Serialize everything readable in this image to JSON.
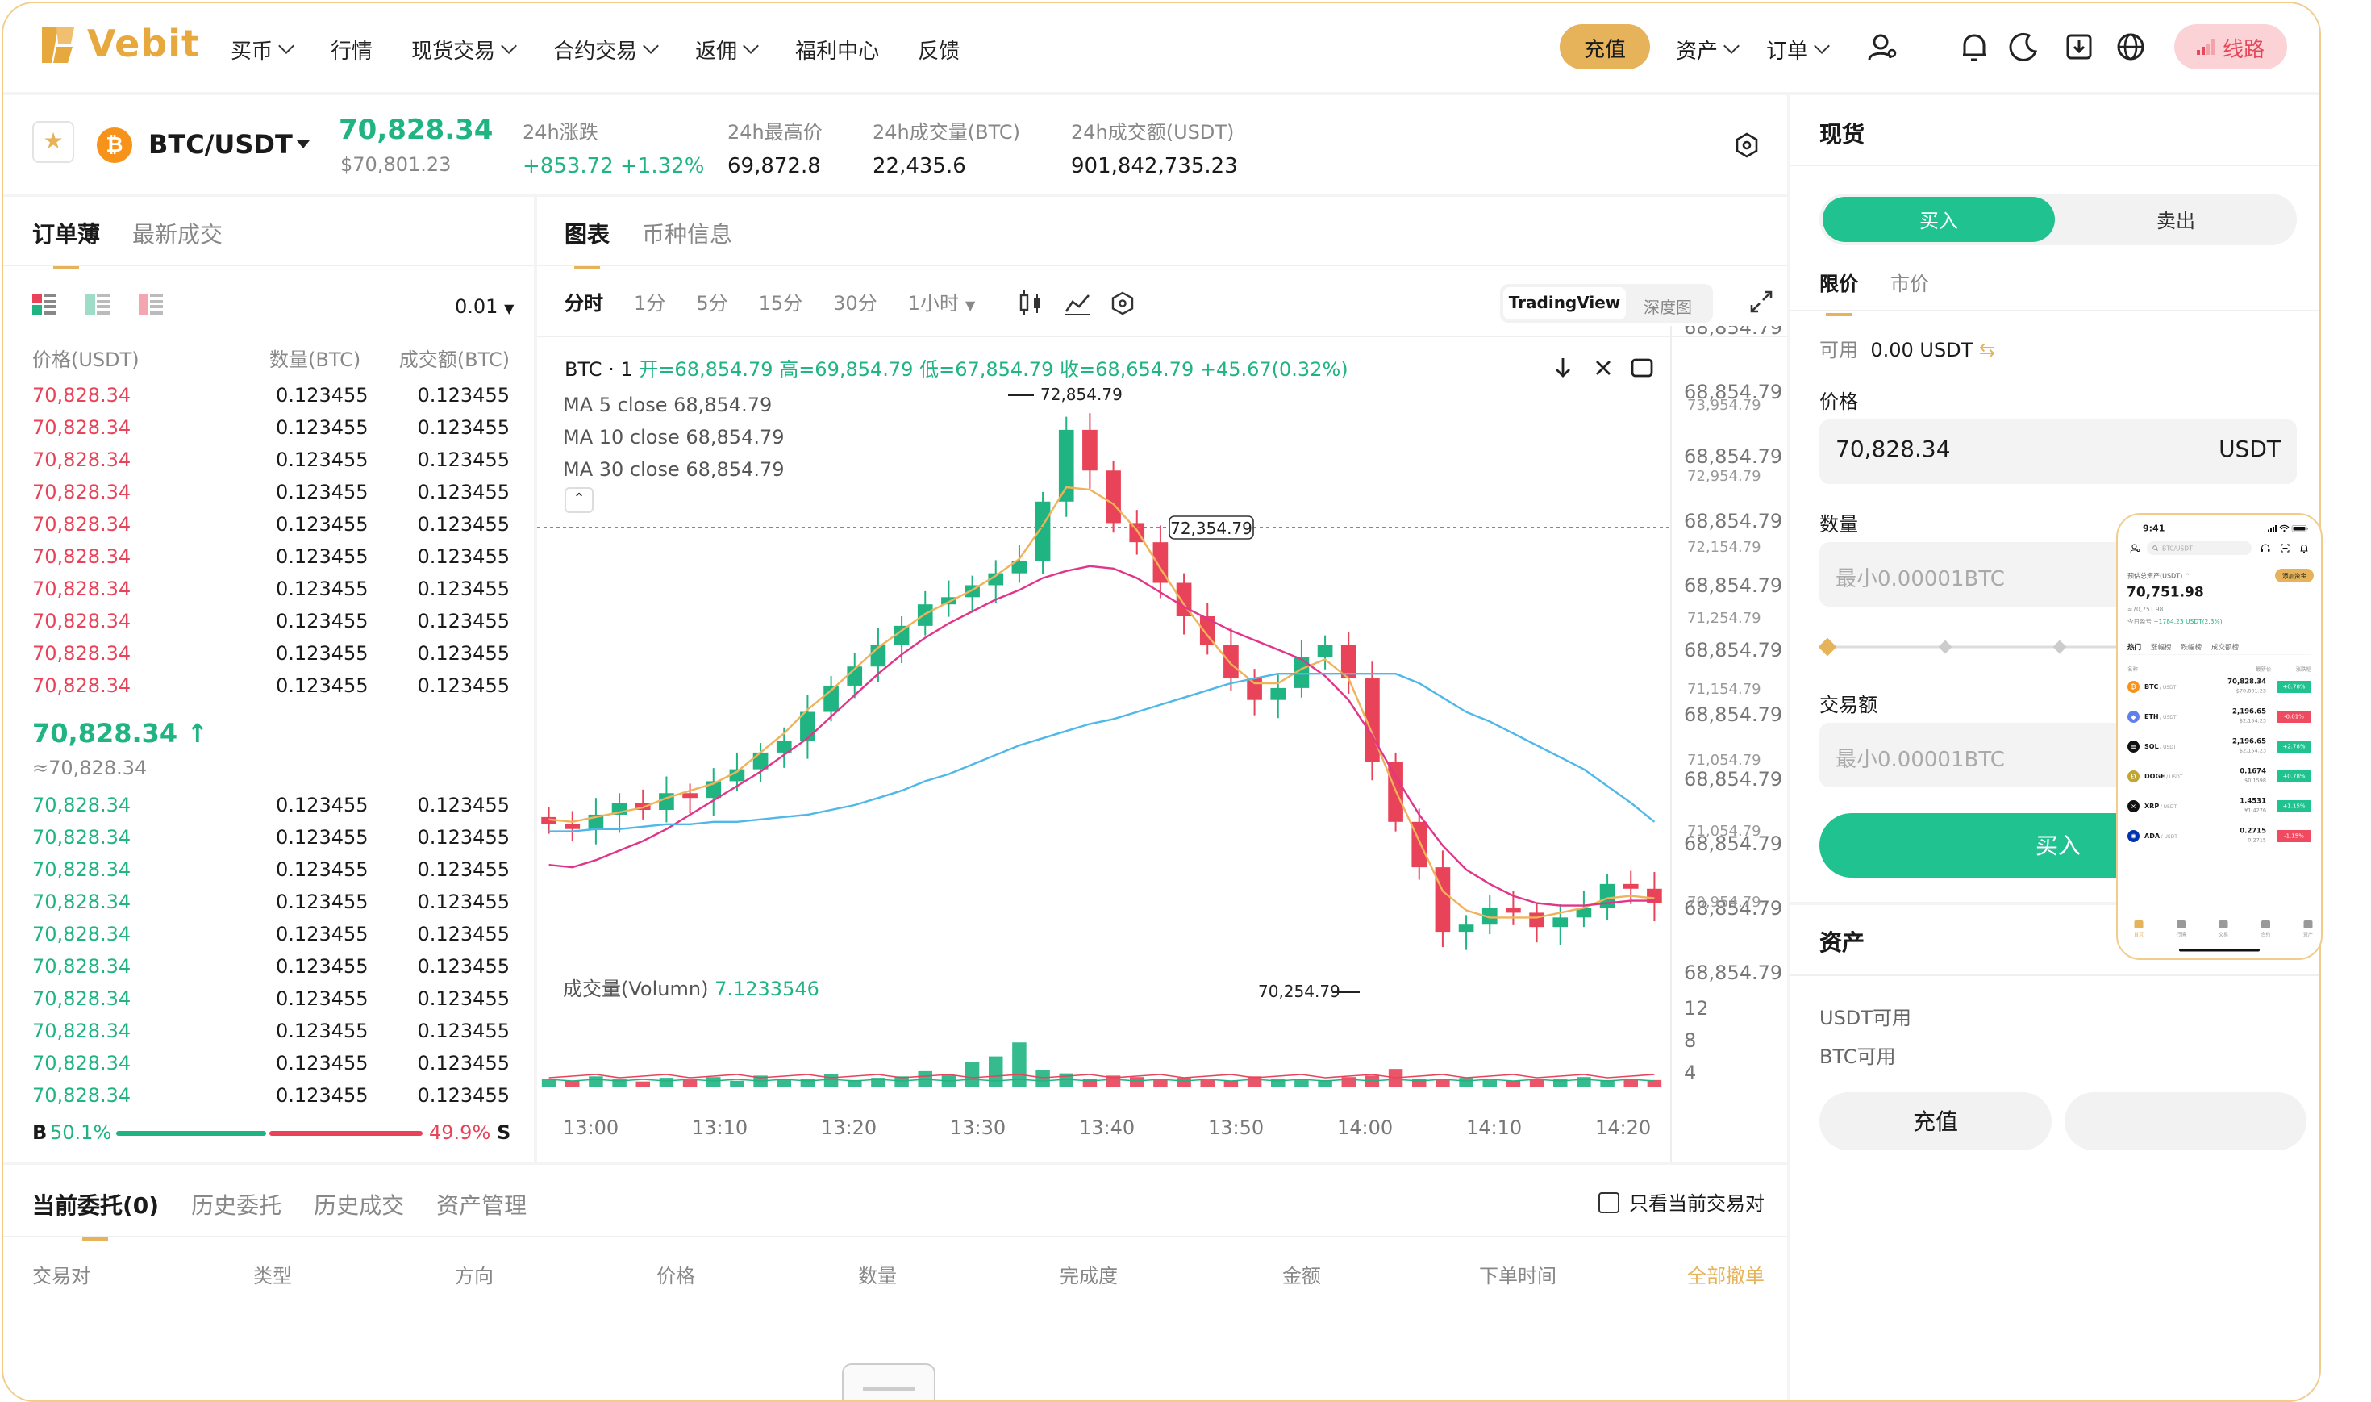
{
  "header": {
    "logo_text": "Vebit",
    "nav": [
      "买币",
      "行情",
      "现货交易",
      "合约交易",
      "返佣",
      "福利中心",
      "反馈"
    ],
    "nav_has_dropdown": [
      true,
      false,
      true,
      true,
      true,
      false,
      false
    ],
    "deposit_label": "充值",
    "assets_label": "资产",
    "orders_label": "订单",
    "route_label": "线路",
    "brand_color": "#e6b25a"
  },
  "ticker": {
    "pair": "BTC/USDT",
    "coin_symbol": "₿",
    "last_price": "70,828.34",
    "last_price_fiat": "$70,801.23",
    "stats": [
      {
        "label": "24h涨跌",
        "value": "+853.72 +1.32%",
        "positive": true
      },
      {
        "label": "24h最高价",
        "value": "69,872.8",
        "positive": false
      },
      {
        "label": "24h成交量(BTC)",
        "value": "22,435.6",
        "positive": false
      },
      {
        "label": "24h成交额(USDT)",
        "value": "901,842,735.23",
        "positive": false
      }
    ]
  },
  "orderbook": {
    "tabs": [
      "订单薄",
      "最新成交"
    ],
    "precision": "0.01",
    "headers": [
      "价格(USDT)",
      "数量(BTC)",
      "成交额(BTC)"
    ],
    "asks": [
      [
        "70,828.34",
        "0.123455",
        "0.123455"
      ],
      [
        "70,828.34",
        "0.123455",
        "0.123455"
      ],
      [
        "70,828.34",
        "0.123455",
        "0.123455"
      ],
      [
        "70,828.34",
        "0.123455",
        "0.123455"
      ],
      [
        "70,828.34",
        "0.123455",
        "0.123455"
      ],
      [
        "70,828.34",
        "0.123455",
        "0.123455"
      ],
      [
        "70,828.34",
        "0.123455",
        "0.123455"
      ],
      [
        "70,828.34",
        "0.123455",
        "0.123455"
      ],
      [
        "70,828.34",
        "0.123455",
        "0.123455"
      ],
      [
        "70,828.34",
        "0.123455",
        "0.123455"
      ]
    ],
    "mid_price": "70,828.34 ↑",
    "mid_price_sub": "≈70,828.34",
    "bids": [
      [
        "70,828.34",
        "0.123455",
        "0.123455"
      ],
      [
        "70,828.34",
        "0.123455",
        "0.123455"
      ],
      [
        "70,828.34",
        "0.123455",
        "0.123455"
      ],
      [
        "70,828.34",
        "0.123455",
        "0.123455"
      ],
      [
        "70,828.34",
        "0.123455",
        "0.123455"
      ],
      [
        "70,828.34",
        "0.123455",
        "0.123455"
      ],
      [
        "70,828.34",
        "0.123455",
        "0.123455"
      ],
      [
        "70,828.34",
        "0.123455",
        "0.123455"
      ],
      [
        "70,828.34",
        "0.123455",
        "0.123455"
      ],
      [
        "70,828.34",
        "0.123455",
        "0.123455"
      ]
    ],
    "buy_label": "B",
    "buy_pct": "50.1%",
    "sell_pct": "49.9%",
    "sell_label": "S",
    "buy_ratio": 0.501
  },
  "chart_panel": {
    "tabs": [
      "图表",
      "币种信息"
    ],
    "timeframes": [
      "分时",
      "1分",
      "5分",
      "15分",
      "30分",
      "1小时"
    ],
    "active_timeframe": "分时",
    "views": [
      "TradingView",
      "深度图"
    ],
    "ohlc_prefix": "BTC · 1",
    "ohlc": "开=68,854.79  高=69,854.79  低=67,854.79  收=68,654.79  +45.67(0.32%)",
    "ma": [
      "MA 5 close 68,854.79",
      "MA 10 close 68,854.79",
      "MA 30 close 68,854.79"
    ],
    "volume_label": "成交量(Volumn)",
    "volume_value": "7.1233546",
    "high_marker": "72,854.79",
    "low_marker": "70,254.79",
    "crosshair_price": "72,354.79",
    "price_axis": [
      "68,854.79",
      "68,854.79",
      "68,854.79",
      "68,854.79",
      "68,854.79",
      "68,854.79",
      "68,854.79",
      "68,854.79",
      "68,854.79",
      "68,854.79",
      "68,854.79"
    ],
    "price_axis_sub": [
      "73,954.79",
      "72,954.79",
      "72,154.79",
      "71,254.79",
      "71,154.79",
      "71,054.79",
      "71,054.79",
      "70,954.79"
    ],
    "volume_axis": [
      "12",
      "8",
      "4"
    ],
    "time_axis": [
      "13:00",
      "13:10",
      "13:20",
      "13:30",
      "13:40",
      "13:50",
      "14:00",
      "14:10",
      "14:20"
    ],
    "up_color": "#20b483",
    "down_color": "#e94359"
  },
  "chart_data": {
    "type": "candlestick",
    "title": "BTC · 1",
    "x_labels": [
      "13:00",
      "13:10",
      "13:20",
      "13:30",
      "13:40",
      "13:50",
      "14:00",
      "14:10",
      "14:20"
    ],
    "y_range": [
      70200,
      72900
    ],
    "close": [
      70950,
      70930,
      70990,
      71040,
      71010,
      71080,
      71060,
      71130,
      71180,
      71250,
      71300,
      71420,
      71530,
      71610,
      71700,
      71780,
      71870,
      71900,
      71950,
      72000,
      72050,
      72300,
      72600,
      72430,
      72210,
      72130,
      71960,
      71820,
      71700,
      71560,
      71470,
      71520,
      71650,
      71700,
      71560,
      71210,
      70960,
      70770,
      70500,
      70530,
      70600,
      70580,
      70520,
      70560,
      70600,
      70700,
      70680,
      70620
    ],
    "ma5": [
      70970,
      70960,
      70980,
      71000,
      71020,
      71060,
      71090,
      71120,
      71170,
      71250,
      71330,
      71430,
      71510,
      71600,
      71690,
      71760,
      71830,
      71880,
      71930,
      71990,
      72060,
      72200,
      72360,
      72350,
      72290,
      72180,
      72020,
      71870,
      71740,
      71620,
      71540,
      71540,
      71600,
      71640,
      71560,
      71330,
      71090,
      70880,
      70670,
      70590,
      70560,
      70560,
      70560,
      70580,
      70600,
      70640,
      70650,
      70640
    ],
    "ma30": [
      70780,
      70770,
      70800,
      70840,
      70880,
      70930,
      70990,
      71050,
      71110,
      71170,
      71240,
      71310,
      71400,
      71490,
      71580,
      71660,
      71730,
      71790,
      71840,
      71890,
      71930,
      71980,
      72010,
      72030,
      72020,
      71980,
      71920,
      71860,
      71810,
      71760,
      71720,
      71680,
      71640,
      71570,
      71470,
      71320,
      71150,
      70990,
      70860,
      70760,
      70700,
      70650,
      70620,
      70610,
      70610,
      70620,
      70630,
      70630
    ],
    "ma60": [
      70920,
      70920,
      70930,
      70930,
      70940,
      70950,
      70950,
      70960,
      70960,
      70970,
      70980,
      70990,
      71010,
      71030,
      71060,
      71090,
      71130,
      71160,
      71200,
      71240,
      71280,
      71310,
      71340,
      71370,
      71390,
      71420,
      71450,
      71480,
      71510,
      71540,
      71560,
      71580,
      71580,
      71580,
      71580,
      71580,
      71580,
      71540,
      71480,
      71420,
      71380,
      71330,
      71280,
      71230,
      71180,
      71110,
      71040,
      70960
    ],
    "volume": [
      1.2,
      0.9,
      1.5,
      1.1,
      0.8,
      1.3,
      1.0,
      1.4,
      0.9,
      1.6,
      1.2,
      1.1,
      1.8,
      1.0,
      1.3,
      1.5,
      2.2,
      1.7,
      3.5,
      4.2,
      6.1,
      2.4,
      1.9,
      1.2,
      1.6,
      1.4,
      1.1,
      1.3,
      1.0,
      0.9,
      1.5,
      1.2,
      1.1,
      1.0,
      1.4,
      1.6,
      2.5,
      1.2,
      1.1,
      1.3,
      1.0,
      0.9,
      1.2,
      1.1,
      1.4,
      1.0,
      1.2,
      1.0
    ]
  },
  "orders": {
    "tabs": [
      "当前委托(0)",
      "历史委托",
      "历史成交",
      "资产管理"
    ],
    "only_current_label": "只看当前交易对",
    "columns": [
      "交易对",
      "类型",
      "方向",
      "价格",
      "数量",
      "完成度",
      "金额",
      "下单时间"
    ],
    "cancel_all": "全部撤单"
  },
  "spot": {
    "title": "现货",
    "buy_tab": "买入",
    "sell_tab": "卖出",
    "order_types": [
      "限价",
      "市价"
    ],
    "available_label": "可用",
    "available_value": "0.00 USDT",
    "price_label": "价格",
    "price_value": "70,828.34",
    "price_unit": "USDT",
    "amount_label": "数量",
    "amount_placeholder": "最小0.00001BTC",
    "total_label": "交易额",
    "total_placeholder": "最小0.00001BTC",
    "buy_button": "买入"
  },
  "assets_panel": {
    "title": "资产",
    "usdt_label": "USDT可用",
    "btc_label": "BTC可用",
    "deposit_button": "充值"
  },
  "phone": {
    "time": "9:41",
    "search_placeholder": "BTC/USDT",
    "total_label": "预估总资产(USDT)",
    "add_funds": "添加资金",
    "total_value": "70,751.98",
    "total_sub": "≈70,751.98",
    "pnl_label": "今日盈亏",
    "pnl_value": "+1784.23 USDT(2.3%)",
    "tabs": [
      "热门",
      "涨幅榜",
      "跌幅榜",
      "成交额榜"
    ],
    "col_name": "名称",
    "col_price": "最新价",
    "col_change": "涨跌幅",
    "coins": [
      {
        "sym": "BTC",
        "quote": "/ USDT",
        "price": "70,828.34",
        "sub": "$70,801.23",
        "chg": "+0.78%",
        "up": true,
        "color": "#f7931a",
        "glyph": "₿"
      },
      {
        "sym": "ETH",
        "quote": "/ USDT",
        "price": "2,196.65",
        "sub": "$2,154.23",
        "chg": "-0.01%",
        "up": false,
        "color": "#627eea",
        "glyph": "◆"
      },
      {
        "sym": "SOL",
        "quote": "/ USDT",
        "price": "2,196.65",
        "sub": "$2,154.23",
        "chg": "+2.78%",
        "up": true,
        "color": "#111111",
        "glyph": "≡"
      },
      {
        "sym": "DOGE",
        "quote": "/ USDT",
        "price": "0.1674",
        "sub": "$0.1598",
        "chg": "+0.78%",
        "up": true,
        "color": "#c2a633",
        "glyph": "Ð"
      },
      {
        "sym": "XRP",
        "quote": "/ USDT",
        "price": "1.4531",
        "sub": "¥1.4276",
        "chg": "+1.15%",
        "up": true,
        "color": "#111111",
        "glyph": "✕"
      },
      {
        "sym": "ADA",
        "quote": "/ USDT",
        "price": "0.2715",
        "sub": "0.2715",
        "chg": "-1.15%",
        "up": false,
        "color": "#0033ad",
        "glyph": "✺"
      }
    ],
    "tabbar": [
      "首页",
      "行情",
      "交易",
      "合约",
      "资产"
    ],
    "active_tab_color": "#e6b25a"
  }
}
